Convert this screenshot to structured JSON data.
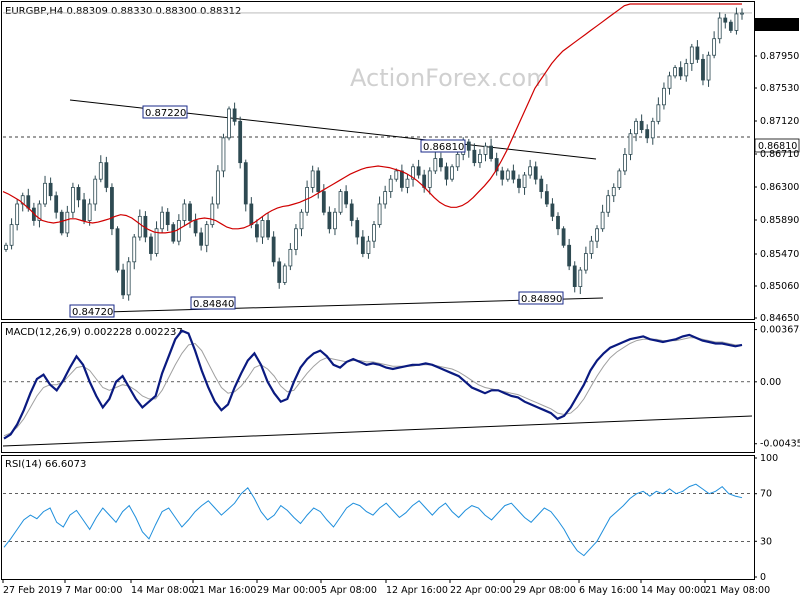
{
  "header": {
    "symbol_line": "EURGBP,H4  0.88309 0.88330 0.88300 0.88312",
    "macd_line": "MACD(12,26,9) 0.002228 0.002237",
    "rsi_line": "RSI(14) 66.6073",
    "watermark": "ActionForex.com"
  },
  "colors": {
    "candle": "#2e4a52",
    "ma": "#d00000",
    "macd": "#0a1a80",
    "signal": "#a0a0a0",
    "rsi": "#1f8fdc",
    "level_box": "#1a2a8a",
    "last_price_bg": "#000000"
  },
  "chart_data": [
    {
      "panel": "price",
      "type": "candlestick",
      "ylim": [
        0.8462,
        0.8842
      ],
      "y_ticks": [
        "0.88312",
        "0.87950",
        "0.87530",
        "0.87120",
        "0.86810",
        "0.86710",
        "0.86300",
        "0.85890",
        "0.85470",
        "0.85060",
        "0.84650"
      ],
      "last_price": "0.88312",
      "horizontal_level": "0.86810",
      "level_labels": [
        "0.87220",
        "0.86810",
        "0.84720",
        "0.84840",
        "0.84890"
      ],
      "close": [
        0.855,
        0.8575,
        0.86,
        0.861,
        0.8595,
        0.858,
        0.86,
        0.8625,
        0.861,
        0.859,
        0.8565,
        0.859,
        0.862,
        0.8605,
        0.858,
        0.86,
        0.863,
        0.865,
        0.862,
        0.857,
        0.852,
        0.849,
        0.853,
        0.856,
        0.8585,
        0.856,
        0.854,
        0.857,
        0.859,
        0.8575,
        0.8555,
        0.858,
        0.86,
        0.858,
        0.8565,
        0.855,
        0.8575,
        0.86,
        0.864,
        0.868,
        0.8715,
        0.87,
        0.865,
        0.86,
        0.8575,
        0.856,
        0.858,
        0.856,
        0.853,
        0.8505,
        0.8525,
        0.8545,
        0.857,
        0.859,
        0.862,
        0.864,
        0.8615,
        0.859,
        0.857,
        0.859,
        0.8615,
        0.86,
        0.858,
        0.856,
        0.854,
        0.8555,
        0.8575,
        0.86,
        0.8615,
        0.863,
        0.864,
        0.862,
        0.863,
        0.8645,
        0.8635,
        0.862,
        0.864,
        0.8655,
        0.8645,
        0.863,
        0.8645,
        0.866,
        0.8675,
        0.8665,
        0.865,
        0.866,
        0.867,
        0.8655,
        0.864,
        0.863,
        0.864,
        0.863,
        0.862,
        0.8635,
        0.8645,
        0.863,
        0.8615,
        0.86,
        0.8585,
        0.857,
        0.855,
        0.8525,
        0.85,
        0.852,
        0.854,
        0.8555,
        0.857,
        0.859,
        0.861,
        0.862,
        0.864,
        0.866,
        0.8685,
        0.87,
        0.869,
        0.868,
        0.87,
        0.872,
        0.874,
        0.8755,
        0.8765,
        0.8755,
        0.877,
        0.879,
        0.8775,
        0.875,
        0.878,
        0.88,
        0.8825,
        0.882,
        0.881,
        0.883,
        0.8831
      ],
      "ma": {
        "name": "",
        "values": [
          0.8615,
          0.8612,
          0.8608,
          0.8604,
          0.8598,
          0.8592,
          0.8585,
          0.858,
          0.8578,
          0.8577,
          0.8578,
          0.858,
          0.8582,
          0.8582,
          0.858,
          0.8578,
          0.8577,
          0.8578,
          0.858,
          0.8582,
          0.8585,
          0.8587,
          0.8586,
          0.8583,
          0.8578,
          0.8573,
          0.8569,
          0.8566,
          0.8565,
          0.8565,
          0.8566,
          0.8568,
          0.8572,
          0.8576,
          0.858,
          0.8582,
          0.8583,
          0.8582,
          0.858,
          0.8576,
          0.8572,
          0.857,
          0.857,
          0.8571,
          0.8574,
          0.8578,
          0.8583,
          0.8588,
          0.8592,
          0.8595,
          0.8597,
          0.8598,
          0.86,
          0.8602,
          0.8605,
          0.8608,
          0.8612,
          0.8616,
          0.862,
          0.8624,
          0.8628,
          0.8632,
          0.8636,
          0.8639,
          0.8642,
          0.8644,
          0.8645,
          0.8646,
          0.8645,
          0.8644,
          0.8642,
          0.864,
          0.8637,
          0.8633,
          0.8628,
          0.8622,
          0.8615,
          0.8608,
          0.8602,
          0.8598,
          0.8596,
          0.8596,
          0.8598,
          0.8602,
          0.8608,
          0.8615,
          0.8622,
          0.863,
          0.864,
          0.8652,
          0.8665,
          0.868,
          0.8695,
          0.871,
          0.8725,
          0.874,
          0.875,
          0.876,
          0.877,
          0.8778,
          0.8785,
          0.879,
          0.8795,
          0.88,
          0.8805,
          0.881,
          0.8815,
          0.882,
          0.8825,
          0.883,
          0.8835,
          0.884,
          0.8845,
          0.885,
          0.8855,
          0.886,
          0.8865,
          0.887,
          0.8875,
          0.888,
          0.8885,
          0.889,
          0.8895,
          0.89,
          0.8905,
          0.891,
          0.8915,
          0.892,
          0.8925,
          0.893,
          0.8935,
          0.894,
          0.8945
        ]
      }
    },
    {
      "panel": "macd",
      "type": "line",
      "ylim": [
        -0.0048,
        0.004
      ],
      "y_ticks": [
        "0.003678",
        "0.00",
        "-0.004359"
      ],
      "series": [
        {
          "name": "",
          "values": [
            -0.004,
            -0.0037,
            -0.003,
            -0.002,
            -0.0008,
            0.0002,
            0.0005,
            -0.0002,
            -0.0006,
            0.0001,
            0.001,
            0.0018,
            0.0012,
            0.0,
            -0.001,
            -0.0018,
            -0.0012,
            0.0,
            0.0004,
            -0.0004,
            -0.0012,
            -0.0018,
            -0.0014,
            -0.001,
            0.0006,
            0.0018,
            0.003,
            0.0036,
            0.0034,
            0.0022,
            0.0008,
            -0.0004,
            -0.0014,
            -0.002,
            -0.0016,
            -0.0004,
            0.0006,
            0.0015,
            0.002,
            0.0012,
            0.0,
            -0.0008,
            -0.0014,
            -0.0012,
            0.0,
            0.001,
            0.0016,
            0.002,
            0.0022,
            0.0018,
            0.0012,
            0.001,
            0.0014,
            0.0016,
            0.0014,
            0.0012,
            0.0013,
            0.0012,
            0.001,
            0.0009,
            0.001,
            0.0011,
            0.0012,
            0.0012,
            0.0013,
            0.0012,
            0.001,
            0.0008,
            0.0006,
            0.0004,
            0.0,
            -0.0004,
            -0.0006,
            -0.0008,
            -0.0006,
            -0.0006,
            -0.0008,
            -0.001,
            -0.0011,
            -0.0014,
            -0.0016,
            -0.0018,
            -0.002,
            -0.0022,
            -0.0026,
            -0.0024,
            -0.0018,
            -0.001,
            -0.0002,
            0.0008,
            0.0015,
            0.002,
            0.0024,
            0.0026,
            0.0028,
            0.003,
            0.0031,
            0.0032,
            0.003,
            0.0029,
            0.0028,
            0.0029,
            0.003,
            0.0032,
            0.0033,
            0.0031,
            0.0029,
            0.0028,
            0.0027,
            0.0027,
            0.0026,
            0.0025,
            0.0026
          ]
        },
        {
          "name": "",
          "values": [
            -0.0038,
            -0.0036,
            -0.0032,
            -0.0026,
            -0.0018,
            -0.001,
            -0.0004,
            -0.0002,
            -0.0002,
            0.0,
            0.0005,
            0.001,
            0.0011,
            0.0008,
            0.0002,
            -0.0004,
            -0.0006,
            -0.0004,
            -0.0002,
            -0.0003,
            -0.0006,
            -0.001,
            -0.0012,
            -0.0012,
            -0.0006,
            0.0003,
            0.0012,
            0.002,
            0.0026,
            0.0027,
            0.0022,
            0.0013,
            0.0004,
            -0.0004,
            -0.0008,
            -0.0007,
            -0.0003,
            0.0003,
            0.001,
            0.0012,
            0.0009,
            0.0004,
            -0.0003,
            -0.0007,
            -0.0006,
            0.0,
            0.0006,
            0.0011,
            0.0015,
            0.0017,
            0.0016,
            0.0015,
            0.0014,
            0.0015,
            0.0015,
            0.0014,
            0.0014,
            0.0013,
            0.0012,
            0.0011,
            0.0011,
            0.0011,
            0.0011,
            0.0012,
            0.0012,
            0.0012,
            0.0011,
            0.001,
            0.0009,
            0.0007,
            0.0004,
            0.0001,
            -0.0002,
            -0.0004,
            -0.0005,
            -0.0006,
            -0.0007,
            -0.0008,
            -0.0009,
            -0.0011,
            -0.0013,
            -0.0015,
            -0.0017,
            -0.0019,
            -0.0022,
            -0.0023,
            -0.0022,
            -0.0018,
            -0.0012,
            -0.0004,
            0.0004,
            0.0011,
            0.0017,
            0.0021,
            0.0024,
            0.0027,
            0.0029,
            0.003,
            0.003,
            0.003,
            0.0029,
            0.0029,
            0.0029,
            0.003,
            0.0031,
            0.0031,
            0.003,
            0.0029,
            0.0028,
            0.0028,
            0.0027,
            0.0026,
            0.0026
          ]
        }
      ]
    },
    {
      "panel": "rsi",
      "type": "line",
      "ylim": [
        0,
        100
      ],
      "y_ticks": [
        "100",
        "70",
        "30",
        "0"
      ],
      "series": [
        {
          "name": "",
          "values": [
            25,
            32,
            40,
            48,
            52,
            49,
            55,
            58,
            46,
            42,
            52,
            56,
            48,
            40,
            50,
            58,
            52,
            46,
            55,
            60,
            50,
            38,
            32,
            44,
            55,
            58,
            50,
            42,
            48,
            55,
            60,
            64,
            58,
            52,
            57,
            62,
            70,
            75,
            66,
            55,
            48,
            52,
            60,
            56,
            50,
            45,
            52,
            58,
            55,
            48,
            42,
            50,
            58,
            62,
            60,
            55,
            52,
            58,
            62,
            56,
            50,
            54,
            60,
            64,
            58,
            52,
            58,
            62,
            55,
            50,
            56,
            60,
            58,
            52,
            48,
            54,
            60,
            62,
            56,
            50,
            46,
            52,
            58,
            55,
            48,
            40,
            30,
            22,
            18,
            24,
            30,
            40,
            50,
            55,
            60,
            66,
            70,
            72,
            68,
            72,
            70,
            74,
            70,
            72,
            76,
            78,
            74,
            70,
            72,
            76,
            70,
            68,
            66.6
          ]
        }
      ]
    }
  ],
  "x_axis": {
    "ticks": [
      "27 Feb 2019",
      "7 Mar 00:00",
      "14 Mar 08:00",
      "21 Mar 16:00",
      "29 Mar 00:00",
      "5 Apr 08:00",
      "12 Apr 16:00",
      "22 Apr 00:00",
      "29 Apr 08:00",
      "6 May 16:00",
      "14 May 00:00",
      "21 May 08:00"
    ]
  }
}
